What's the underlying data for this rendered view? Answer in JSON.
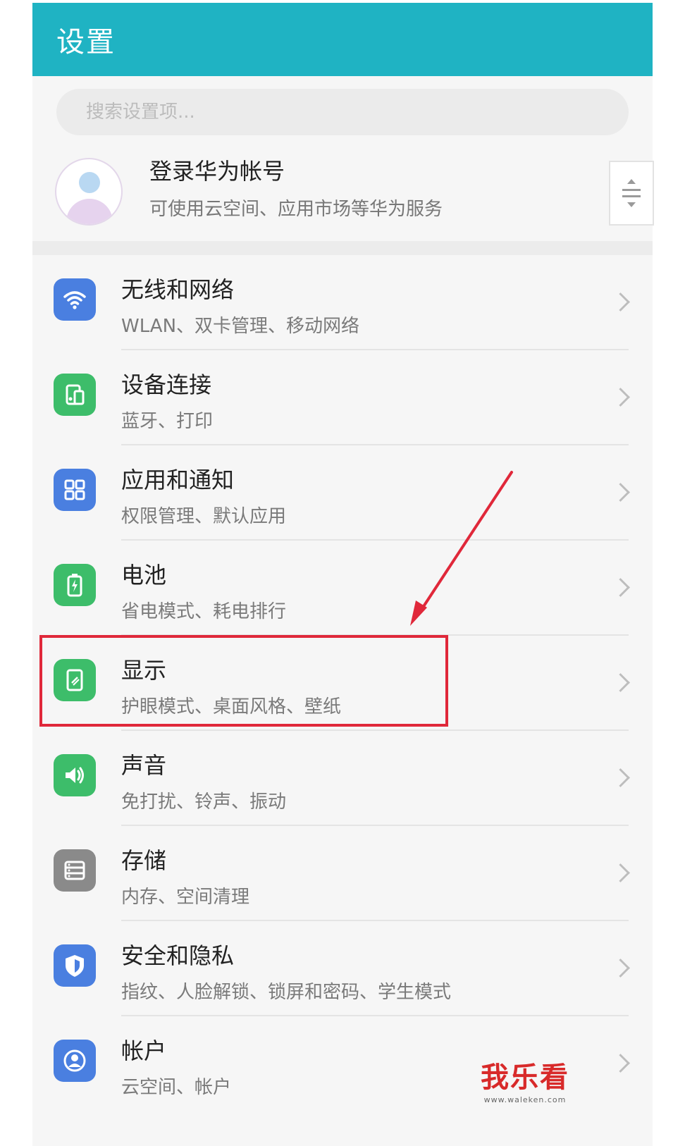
{
  "header": {
    "title": "设置"
  },
  "search": {
    "placeholder": "搜索设置项..."
  },
  "account": {
    "title": "登录华为帐号",
    "subtitle": "可使用云空间、应用市场等华为服务"
  },
  "items": [
    {
      "title": "无线和网络",
      "subtitle": "WLAN、双卡管理、移动网络",
      "icon": "wifi-icon",
      "color": "#4a7fe0"
    },
    {
      "title": "设备连接",
      "subtitle": "蓝牙、打印",
      "icon": "device-connect-icon",
      "color": "#3dbd6a"
    },
    {
      "title": "应用和通知",
      "subtitle": "权限管理、默认应用",
      "icon": "apps-grid-icon",
      "color": "#4a7fe0"
    },
    {
      "title": "电池",
      "subtitle": "省电模式、耗电排行",
      "icon": "battery-icon",
      "color": "#3dbd6a"
    },
    {
      "title": "显示",
      "subtitle": "护眼模式、桌面风格、壁纸",
      "icon": "display-icon",
      "color": "#3dbd6a"
    },
    {
      "title": "声音",
      "subtitle": "免打扰、铃声、振动",
      "icon": "sound-icon",
      "color": "#3dbd6a"
    },
    {
      "title": "存储",
      "subtitle": "内存、空间清理",
      "icon": "storage-icon",
      "color": "#8a8a8a"
    },
    {
      "title": "安全和隐私",
      "subtitle": "指纹、人脸解锁、锁屏和密码、学生模式",
      "icon": "shield-icon",
      "color": "#4a7fe0"
    },
    {
      "title": "帐户",
      "subtitle": "云空间、帐户",
      "icon": "account-icon",
      "color": "#4a7fe0"
    }
  ],
  "annotation": {
    "highlight_color": "#e0283a"
  },
  "watermark": {
    "text": "我乐看",
    "url": "www.waleken.com"
  }
}
